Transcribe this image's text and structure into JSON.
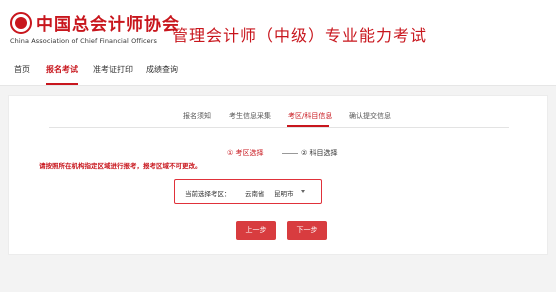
{
  "header": {
    "logo_cn": "中国总会计师协会",
    "logo_en": "China Association of Chief Financial Officers",
    "site_title": "管理会计师（中级）专业能力考试"
  },
  "nav": {
    "items": [
      {
        "label": "首页",
        "active": false
      },
      {
        "label": "报名考试",
        "active": true
      },
      {
        "label": "准考证打印",
        "active": false
      },
      {
        "label": "成绩查询",
        "active": false
      }
    ]
  },
  "steps": [
    {
      "label": "报名须知",
      "active": false
    },
    {
      "label": "考生信息采集",
      "active": false
    },
    {
      "label": "考区/科目信息",
      "active": true
    },
    {
      "label": "确认提交信息",
      "active": false
    }
  ],
  "sub_steps": [
    {
      "label": "① 考区选择",
      "active": true
    },
    {
      "label": "② 科目选择",
      "active": false
    }
  ],
  "warning": "请按照所在机构指定区域进行报考，报考区域不可更改。",
  "selection": {
    "label": "当前选择考区：",
    "province": "云南省",
    "city": "昆明市"
  },
  "buttons": {
    "prev": "上一步",
    "next": "下一步"
  },
  "colors": {
    "brand_red": "#c8161d",
    "button_red": "#d83c3f"
  }
}
